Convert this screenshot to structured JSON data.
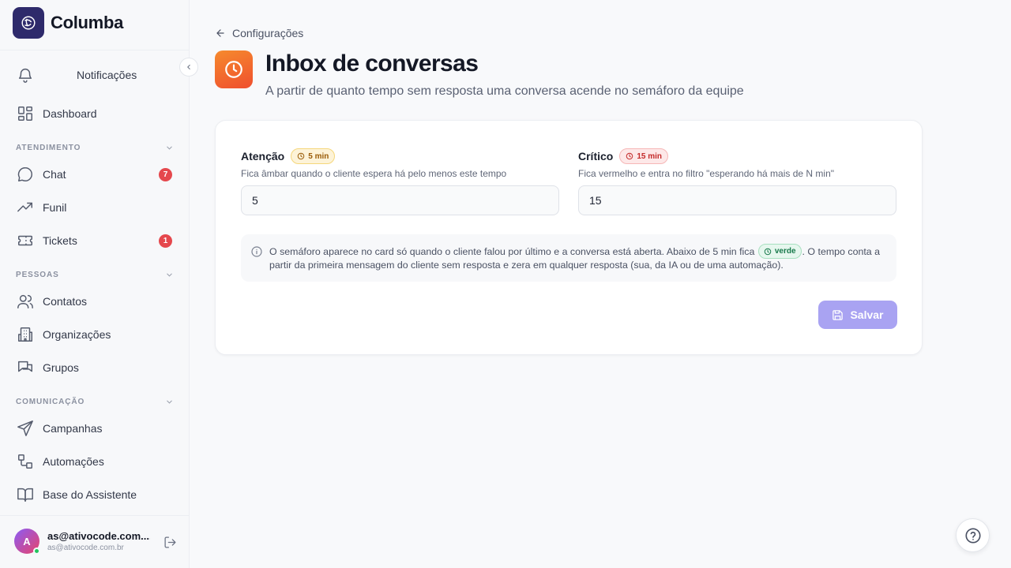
{
  "brand": {
    "name": "Columba"
  },
  "sidebar": {
    "notifications_label": "Notificações",
    "dashboard_label": "Dashboard",
    "sections": {
      "atendimento": "ATENDIMENTO",
      "pessoas": "PESSOAS",
      "comunicacao": "COMUNICAÇÃO"
    },
    "items": {
      "chat": {
        "label": "Chat",
        "badge": "7"
      },
      "funil": {
        "label": "Funil"
      },
      "tickets": {
        "label": "Tickets",
        "badge": "1"
      },
      "contatos": {
        "label": "Contatos"
      },
      "organizacoes": {
        "label": "Organizações"
      },
      "grupos": {
        "label": "Grupos"
      },
      "campanhas": {
        "label": "Campanhas"
      },
      "automacoes": {
        "label": "Automações"
      },
      "base": {
        "label": "Base do Assistente"
      }
    },
    "user": {
      "initial": "A",
      "name": "as@ativocode.com....",
      "email": "as@ativocode.com.br"
    }
  },
  "page": {
    "back_label": "Configurações",
    "title": "Inbox de conversas",
    "subtitle": "A partir de quanto tempo sem resposta uma conversa acende no semáforo da equipe"
  },
  "form": {
    "attention": {
      "title": "Atenção",
      "pill": "5 min",
      "description": "Fica âmbar quando o cliente espera há pelo menos este tempo",
      "value": "5"
    },
    "critical": {
      "title": "Crítico",
      "pill": "15 min",
      "description": "Fica vermelho e entra no filtro \"esperando há mais de N min\"",
      "value": "15"
    },
    "info": {
      "before": "O semáforo aparece no card só quando o cliente falou por último e a conversa está aberta. Abaixo de 5 min fica",
      "pill": "verde",
      "after": ". O tempo conta a partir da primeira mensagem do cliente sem resposta e zera em qualquer resposta (sua, da IA ou de uma automação)."
    },
    "save_label": "Salvar"
  },
  "colors": {
    "accent": "#a9a3f2",
    "amber": "#9a5b08",
    "red": "#c42b2b",
    "green": "#16794a",
    "badge": "#e5484d",
    "page_icon": "#f26b2e"
  },
  "icons": {
    "brand": "logo-icon",
    "notifications": "bell-icon",
    "dashboard": "grid-icon",
    "chat": "chat-bubble-icon",
    "funil": "trend-icon",
    "tickets": "ticket-icon",
    "contatos": "users-icon",
    "organizacoes": "building-icon",
    "grupos": "messages-icon",
    "campanhas": "send-icon",
    "automacoes": "workflow-icon",
    "base": "book-icon",
    "page": "clock-icon",
    "help": "question-icon"
  }
}
